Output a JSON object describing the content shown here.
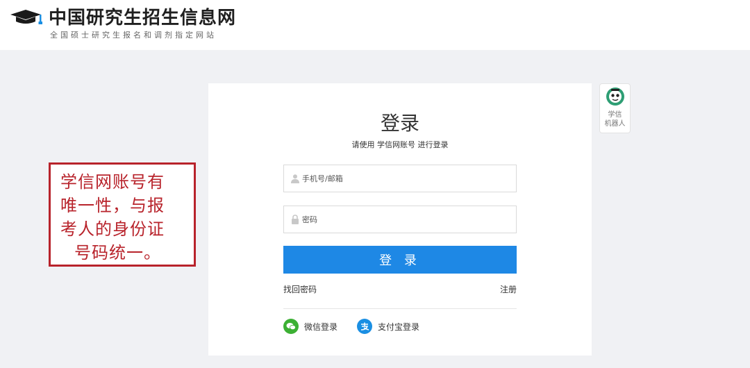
{
  "header": {
    "logo_icon": "graduation-cap-icon",
    "title": "中国研究生招生信息网",
    "subtitle": "全国硕士研究生报名和调剂指定网站"
  },
  "login": {
    "title": "登录",
    "hint": "请使用 学信网账号 进行登录",
    "phone_placeholder": "手机号/邮箱",
    "phone_icon": "user-icon",
    "password_placeholder": "密码",
    "password_icon": "lock-icon",
    "button_label": "登 录",
    "forgot_label": "找回密码",
    "register_label": "注册",
    "wechat_label": "微信登录",
    "wechat_icon": "wechat-icon",
    "alipay_label": "支付宝登录",
    "alipay_icon": "alipay-icon"
  },
  "robot": {
    "label_line1": "学信",
    "label_line2": "机器人",
    "icon": "robot-avatar-icon"
  },
  "annotation": {
    "lines": [
      "学信网账号有",
      "唯一性，与报",
      "考人的身份证",
      "号码统一。"
    ]
  },
  "colors": {
    "primary_button": "#1e88e5",
    "annotation_red": "#b8232b",
    "wechat_green": "#3cb034",
    "alipay_blue": "#1a8fe3",
    "page_background": "#f0f1f4"
  }
}
